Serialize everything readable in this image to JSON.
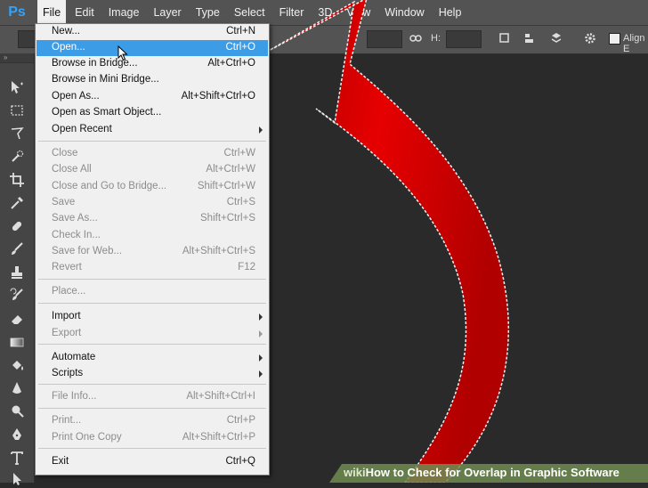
{
  "app": {
    "logo": "Ps"
  },
  "menubar": {
    "items": [
      "File",
      "Edit",
      "Image",
      "Layer",
      "Type",
      "Select",
      "Filter",
      "3D",
      "View",
      "Window",
      "Help"
    ]
  },
  "options_bar": {
    "h_label": "H:",
    "align_label": "Align E"
  },
  "toolbox": {
    "header": "»"
  },
  "file_menu": {
    "groups": [
      [
        {
          "label": "New...",
          "shortcut": "Ctrl+N",
          "enabled": true
        },
        {
          "label": "Open...",
          "shortcut": "Ctrl+O",
          "enabled": true,
          "highlighted": true
        },
        {
          "label": "Browse in Bridge...",
          "shortcut": "Alt+Ctrl+O",
          "enabled": true
        },
        {
          "label": "Browse in Mini Bridge...",
          "shortcut": "",
          "enabled": true
        },
        {
          "label": "Open As...",
          "shortcut": "Alt+Shift+Ctrl+O",
          "enabled": true
        },
        {
          "label": "Open as Smart Object...",
          "shortcut": "",
          "enabled": true
        },
        {
          "label": "Open Recent",
          "shortcut": "",
          "enabled": true,
          "submenu": true
        }
      ],
      [
        {
          "label": "Close",
          "shortcut": "Ctrl+W",
          "enabled": false
        },
        {
          "label": "Close All",
          "shortcut": "Alt+Ctrl+W",
          "enabled": false
        },
        {
          "label": "Close and Go to Bridge...",
          "shortcut": "Shift+Ctrl+W",
          "enabled": false
        },
        {
          "label": "Save",
          "shortcut": "Ctrl+S",
          "enabled": false
        },
        {
          "label": "Save As...",
          "shortcut": "Shift+Ctrl+S",
          "enabled": false
        },
        {
          "label": "Check In...",
          "shortcut": "",
          "enabled": false
        },
        {
          "label": "Save for Web...",
          "shortcut": "Alt+Shift+Ctrl+S",
          "enabled": false
        },
        {
          "label": "Revert",
          "shortcut": "F12",
          "enabled": false
        }
      ],
      [
        {
          "label": "Place...",
          "shortcut": "",
          "enabled": false
        }
      ],
      [
        {
          "label": "Import",
          "shortcut": "",
          "enabled": true,
          "submenu": true
        },
        {
          "label": "Export",
          "shortcut": "",
          "enabled": false,
          "submenu": true
        }
      ],
      [
        {
          "label": "Automate",
          "shortcut": "",
          "enabled": true,
          "submenu": true
        },
        {
          "label": "Scripts",
          "shortcut": "",
          "enabled": true,
          "submenu": true
        }
      ],
      [
        {
          "label": "File Info...",
          "shortcut": "Alt+Shift+Ctrl+I",
          "enabled": false
        }
      ],
      [
        {
          "label": "Print...",
          "shortcut": "Ctrl+P",
          "enabled": false
        },
        {
          "label": "Print One Copy",
          "shortcut": "Alt+Shift+Ctrl+P",
          "enabled": false
        }
      ],
      [
        {
          "label": "Exit",
          "shortcut": "Ctrl+Q",
          "enabled": true
        }
      ]
    ]
  },
  "watermark": {
    "brand": "wiki",
    "title": "How to Check for Overlap in Graphic Software"
  },
  "colors": {
    "menubar": "#535353",
    "workspace": "#2a2a2a",
    "menu_bg": "#f0f0f0",
    "highlight": "#3c9ce6",
    "arrow_red": "#d40000",
    "ps_blue": "#2fa3ff"
  }
}
